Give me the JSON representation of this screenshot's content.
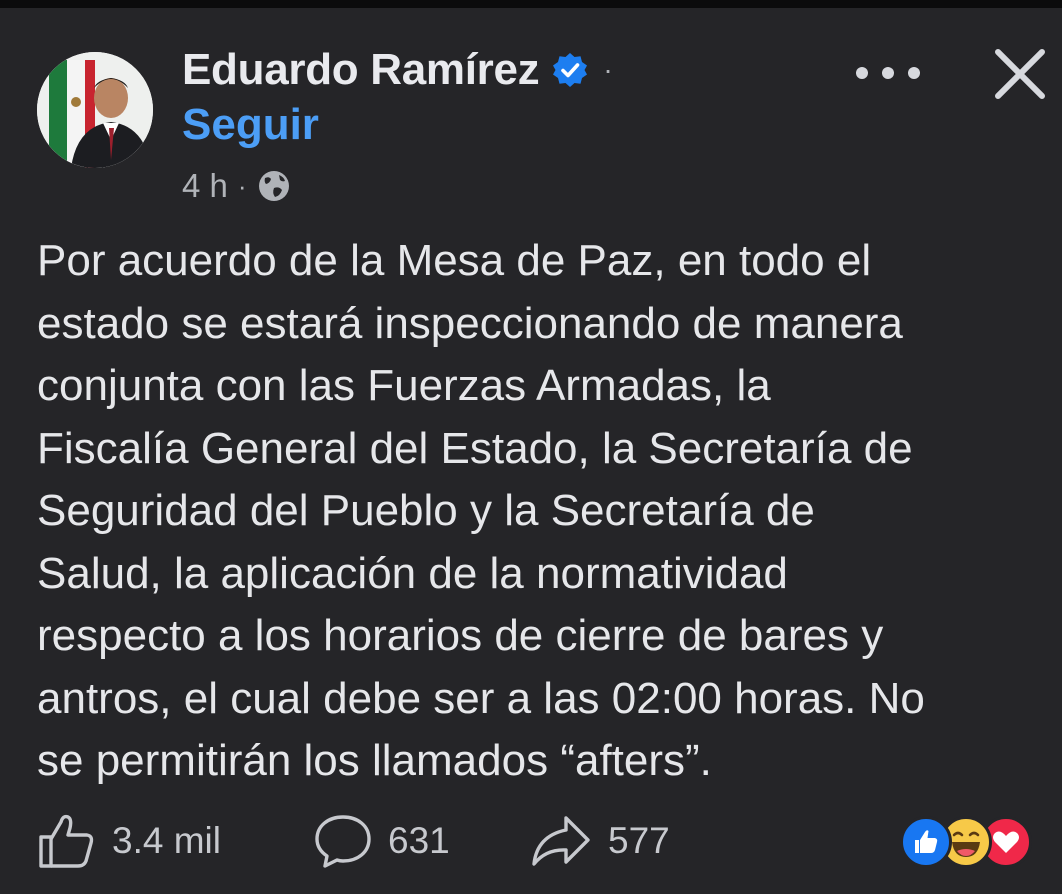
{
  "post": {
    "author": "Eduardo Ramírez",
    "name_separator": "·",
    "follow_label": "Seguir",
    "time": "4 h",
    "meta_separator": "·",
    "audience_icon": "globe-icon",
    "text": "Por acuerdo de la Mesa de Paz, en todo el\nestado se estará inspeccionando de manera\nconjunta con las Fuerzas Armadas, la\nFiscalía General del Estado, la Secretaría de\nSeguridad del Pueblo y la Secretaría de\nSalud, la aplicación de la normatividad\nrespecto a los horarios de cierre de bares y\nantros, el cual debe ser a las 02:00 horas. No\nse permitirán los llamados “afters”."
  },
  "actions": {
    "likes": "3.4 mil",
    "comments": "631",
    "shares": "577"
  },
  "reactions": [
    "like-reaction-icon",
    "haha-reaction-icon",
    "love-reaction-icon"
  ],
  "colors": {
    "background": "#252528",
    "follow_blue": "#4c9ef6",
    "verified_blue": "#1d7ef0"
  }
}
